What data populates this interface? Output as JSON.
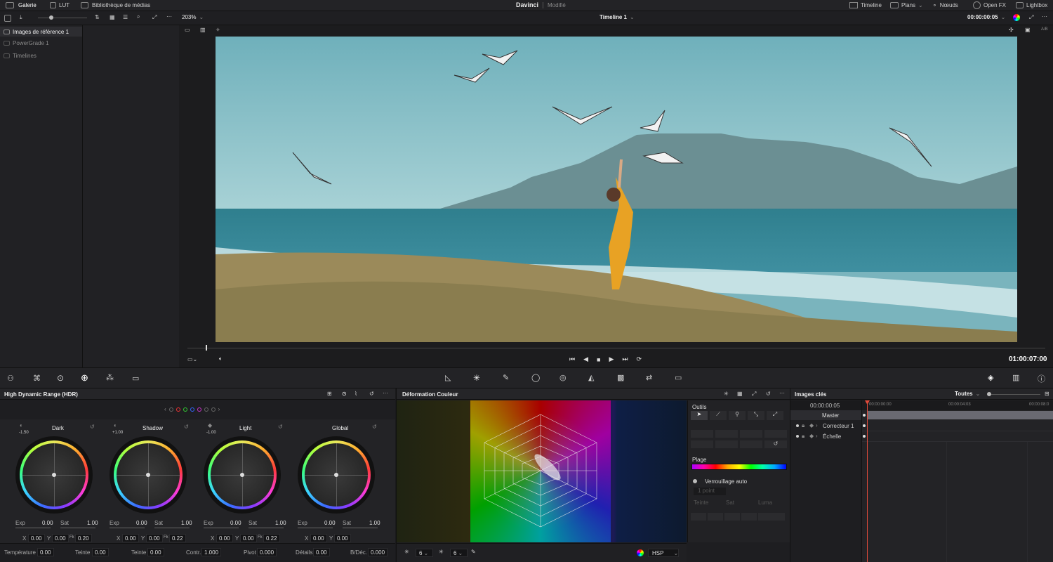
{
  "top": {
    "left_tabs": [
      {
        "label": "Galerie",
        "icon": "gallery-icon"
      },
      {
        "label": "LUT",
        "icon": "lut-icon"
      },
      {
        "label": "Bibliothèque de médias",
        "icon": "media-library-icon"
      }
    ],
    "app_title": "Davinci",
    "status": "Modifié",
    "right_tabs": [
      {
        "label": "Timeline",
        "icon": "timeline-icon"
      },
      {
        "label": "Plans",
        "icon": "clips-icon"
      },
      {
        "label": "Nœuds",
        "icon": "nodes-icon"
      },
      {
        "label": "Open FX",
        "icon": "fx-icon"
      },
      {
        "label": "Lightbox",
        "icon": "lightbox-icon"
      }
    ]
  },
  "toolbar": {
    "zoom": "203%",
    "timeline_name": "Timeline 1",
    "timecode": "00:00:00:05"
  },
  "gallery": {
    "items": [
      "Images de référence 1",
      "PowerGrade 1",
      "Timelines"
    ]
  },
  "viewer": {
    "timecode": "01:00:07:00"
  },
  "color_wheels": {
    "title": "High Dynamic Range (HDR)",
    "wheels": [
      {
        "name": "Dark",
        "top_val": "-1.50",
        "exp": "0.00",
        "sat": "1.00",
        "x": "0.00",
        "y": "0.00",
        "z": "0.20",
        "z_label": "Fk"
      },
      {
        "name": "Shadow",
        "top_val": "+1.00",
        "exp": "0.00",
        "sat": "1.00",
        "x": "0.00",
        "y": "0.00",
        "z": "0.22",
        "z_label": "Fk"
      },
      {
        "name": "Light",
        "top_val": "-1.00",
        "exp": "0.00",
        "sat": "1.00",
        "x": "0.00",
        "y": "0.00",
        "z": "0.22",
        "z_label": "Fk"
      },
      {
        "name": "Global",
        "top_val": "",
        "exp": "0.00",
        "sat": "1.00",
        "x": "0.00",
        "y": "0.00",
        "z": "",
        "z_label": ""
      }
    ],
    "exp_label": "Exp",
    "sat_label": "Sat",
    "x_label": "X",
    "y_label": "Y",
    "bottom": [
      {
        "label": "Température",
        "value": "0.00"
      },
      {
        "label": "Teinte",
        "value": "0.00"
      },
      {
        "label": "Teinte",
        "value": "0.00"
      },
      {
        "label": "Contr.",
        "value": "1.000"
      },
      {
        "label": "Pivot",
        "value": "0.000"
      },
      {
        "label": "Détails",
        "value": "0.00"
      },
      {
        "label": "B/Déc.",
        "value": "0.000"
      }
    ]
  },
  "warper": {
    "title": "Déformation Couleur",
    "tools_label": "Outils",
    "plage_label": "Plage",
    "lock_label": "Verrouillage auto",
    "point_option": "1 point",
    "teinte_label": "Teinte",
    "sat_label": "Sat",
    "luma_label": "Luma",
    "grid1": "6",
    "grid2": "6",
    "colorspace": "HSP"
  },
  "keyframes": {
    "title": "Images clés",
    "filter": "Toutes",
    "timecode": "00:00:00:05",
    "ruler": [
      "00:00:00:00",
      "00:00:04:03",
      "00:00:08:0"
    ],
    "tracks": [
      "Master",
      "Correcteur 1",
      "Échelle"
    ]
  }
}
